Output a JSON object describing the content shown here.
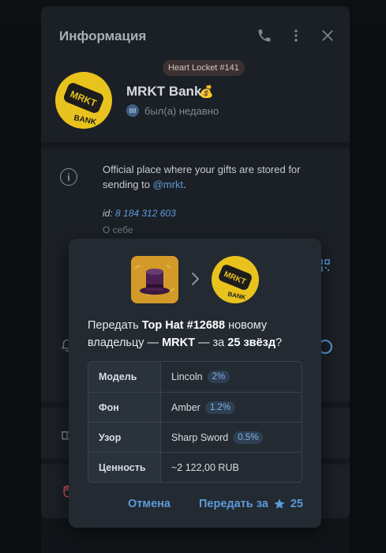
{
  "panel": {
    "title": "Информация",
    "locket_badge": "Heart Locket #141",
    "profile_name": "MRKT Bank",
    "profile_status": "был(а) недавно",
    "status_badge_number": "88",
    "avatar_text_top": "MRKT",
    "avatar_text_bottom": "BANK",
    "bio_before_link": "Official place where your gifts are stored for sending to ",
    "bio_link": "@mrkt",
    "bio_after_link": ".",
    "id_label": "id: ",
    "id_value": "8 184 312 603",
    "about_label": "О себе",
    "icons": [
      "phone-icon",
      "more-vert-icon",
      "close-icon",
      "info-icon",
      "bell-icon",
      "gift-icon",
      "hand-icon",
      "qr-icon",
      "toggle-icon"
    ]
  },
  "modal": {
    "transfer_prefix": "Передать ",
    "gift_name": "Top Hat #12688",
    "transfer_mid": " новому владельцу — ",
    "recipient": "MRKT",
    "transfer_price_prefix": " — за ",
    "price": "25 звёзд",
    "transfer_suffix": "?",
    "attributes": [
      {
        "key": "Модель",
        "value": "Lincoln",
        "pct": "2%"
      },
      {
        "key": "Фон",
        "value": "Amber",
        "pct": "1.2%"
      },
      {
        "key": "Узор",
        "value": "Sharp Sword",
        "pct": "0.5%"
      },
      {
        "key": "Ценность",
        "value": "~2 122,00 RUB",
        "pct": ""
      }
    ],
    "cancel_label": "Отмена",
    "transfer_label": "Передать за",
    "transfer_stars": "25"
  },
  "colors": {
    "accent": "#5d9ad9",
    "avatar_yellow": "#e9c31d",
    "gift_bg": "#d39a2a"
  }
}
